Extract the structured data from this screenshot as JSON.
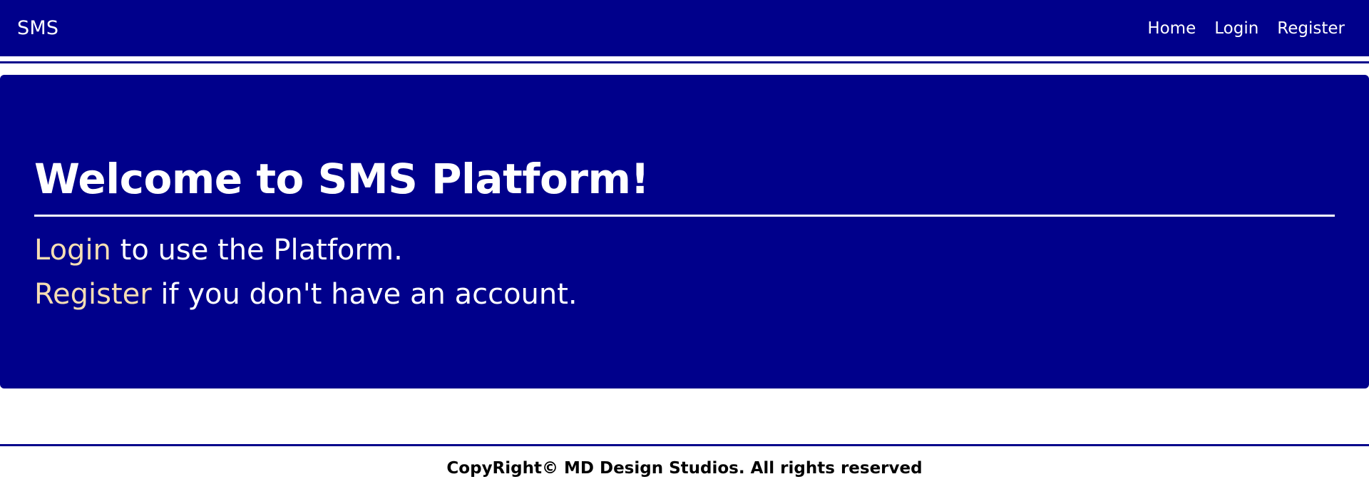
{
  "navbar": {
    "brand": "SMS",
    "links": [
      "Home",
      "Login",
      "Register"
    ]
  },
  "hero": {
    "title": "Welcome to SMS Platform!",
    "line1_link": "Login",
    "line1_text": " to use the Platform.",
    "line2_link": "Register",
    "line2_text": " if you don't have an account."
  },
  "footer": {
    "text": "CopyRight© MD Design Studios. All rights reserved"
  },
  "colors": {
    "primary": "#00008b",
    "link_accent": "#f5deb3",
    "text_light": "#ffffff",
    "text_dark": "#000000"
  }
}
